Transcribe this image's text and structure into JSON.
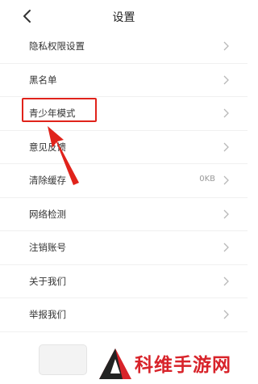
{
  "header": {
    "title": "设置",
    "back_icon": "chevron-left-icon"
  },
  "menu": [
    {
      "key": "privacy",
      "label": "隐私权限设置",
      "value": ""
    },
    {
      "key": "blacklist",
      "label": "黑名单",
      "value": ""
    },
    {
      "key": "youth-mode",
      "label": "青少年模式",
      "value": ""
    },
    {
      "key": "feedback",
      "label": "意见反馈",
      "value": ""
    },
    {
      "key": "clear-cache",
      "label": "清除缓存",
      "value": "0KB"
    },
    {
      "key": "network-check",
      "label": "网络检测",
      "value": ""
    },
    {
      "key": "cancel-account",
      "label": "注销账号",
      "value": ""
    },
    {
      "key": "about",
      "label": "关于我们",
      "value": ""
    },
    {
      "key": "report",
      "label": "举报我们",
      "value": ""
    }
  ],
  "watermark": {
    "text": "科维手游网"
  },
  "colors": {
    "highlight": "#e0231b",
    "watermark": "#d8232a"
  }
}
